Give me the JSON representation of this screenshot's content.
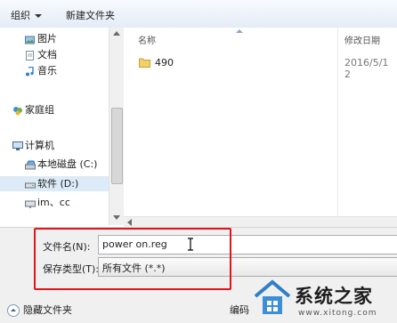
{
  "toolbar": {
    "organize_label": "组织",
    "new_folder_label": "新建文件夹"
  },
  "nav": {
    "items": [
      {
        "label": "图片",
        "icon": "pictures-icon"
      },
      {
        "label": "文档",
        "icon": "documents-icon"
      },
      {
        "label": "音乐",
        "icon": "music-icon"
      },
      {
        "label": "家庭组",
        "icon": "homegroup-icon"
      },
      {
        "label": "计算机",
        "icon": "computer-icon"
      },
      {
        "label": "本地磁盘 (C:)",
        "icon": "local-disk-icon"
      },
      {
        "label": "软件 (D:)",
        "icon": "drive-icon"
      },
      {
        "label": "im、cc",
        "icon": "network-drive-icon"
      }
    ]
  },
  "list": {
    "columns": {
      "name": "名称",
      "date": "修改日期"
    },
    "rows": [
      {
        "name": "490",
        "date": "2016/5/1 2"
      }
    ]
  },
  "form": {
    "filename_label": "文件名(N):",
    "filename_value": "power on.reg",
    "filetype_label": "保存类型(T):",
    "filetype_value": "所有文件 (*.*)"
  },
  "footer": {
    "hide_folders_label": "隐藏文件夹",
    "encoding_label": "编码"
  },
  "watermark": {
    "text": "系统之家",
    "url": "www.xitong.com"
  },
  "colors": {
    "highlight": "#e0161b",
    "selection": "#ddeaf7"
  }
}
